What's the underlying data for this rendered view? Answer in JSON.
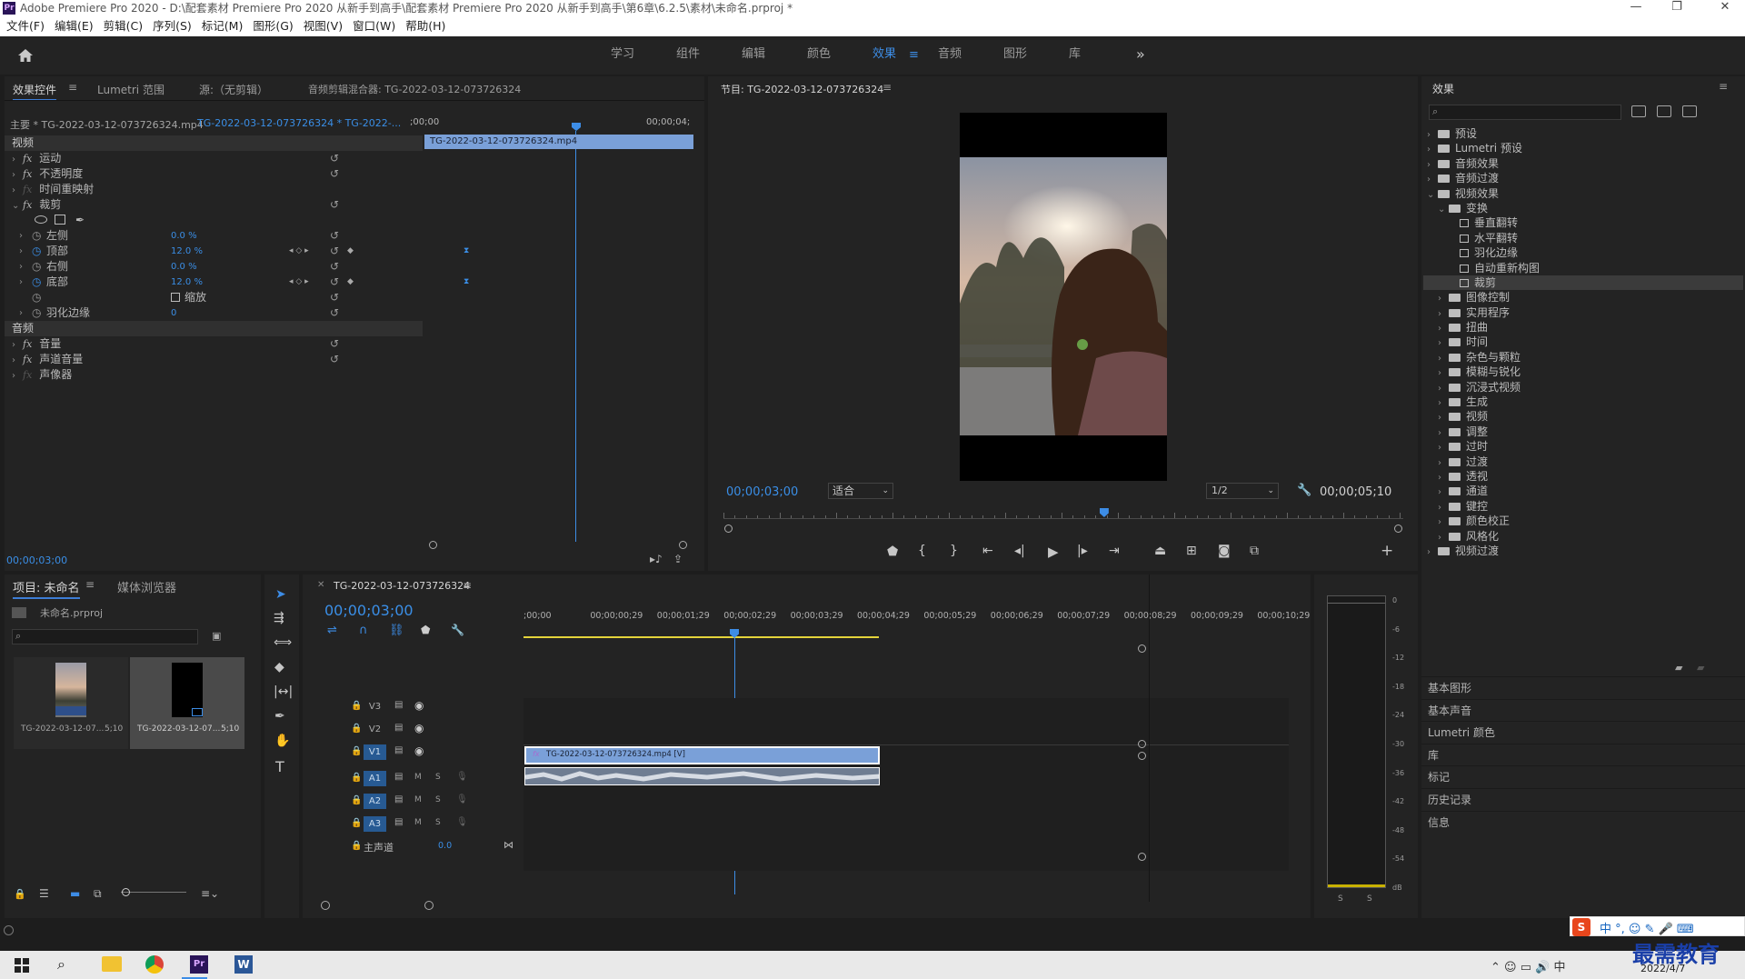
{
  "window": {
    "title": "Adobe Premiere Pro 2020 - D:\\配套素材 Premiere Pro 2020 从新手到高手\\配套素材 Premiere Pro 2020 从新手到高手\\第6章\\6.2.5\\素材\\未命名.prproj *",
    "logo": "Pr",
    "minimize": "—",
    "restore": "❐",
    "close": "✕"
  },
  "menu": [
    "文件(F)",
    "编辑(E)",
    "剪辑(C)",
    "序列(S)",
    "标记(M)",
    "图形(G)",
    "视图(V)",
    "窗口(W)",
    "帮助(H)"
  ],
  "workspaces": {
    "tabs": [
      "学习",
      "组件",
      "编辑",
      "颜色",
      "效果",
      "音频",
      "图形",
      "库"
    ],
    "active": "效果",
    "more": "»"
  },
  "effect_controls": {
    "tabs": [
      "效果控件",
      "Lumetri 范围",
      "源:（无剪辑）",
      "音频剪辑混合器: TG-2022-03-12-073726324"
    ],
    "master": "主要 * TG-2022-03-12-073726324.mp4",
    "sequence_clip": "TG-2022-03-12-073726324 * TG-2022-...",
    "ruler_start": ";00;00",
    "ruler_end": "00;00;04;",
    "clip_bar": "TG-2022-03-12-073726324.mp4",
    "video_section": "视频",
    "audio_section": "音频",
    "video_effects": [
      {
        "name": "运动",
        "fx": true
      },
      {
        "name": "不透明度",
        "fx": true
      },
      {
        "name": "时间重映射",
        "fx": false
      },
      {
        "name": "裁剪",
        "fx": true
      }
    ],
    "crop_params": [
      {
        "name": "左侧",
        "value": "0.0 %",
        "animated": false
      },
      {
        "name": "顶部",
        "value": "12.0 %",
        "animated": true
      },
      {
        "name": "右侧",
        "value": "0.0 %",
        "animated": false
      },
      {
        "name": "底部",
        "value": "12.0 %",
        "animated": true
      },
      {
        "name": "",
        "value": "",
        "checkbox": "缩放"
      },
      {
        "name": "羽化边缘",
        "value": "0",
        "animated": false
      }
    ],
    "audio_effects": [
      {
        "name": "音量",
        "fx": true
      },
      {
        "name": "声道音量",
        "fx": true
      },
      {
        "name": "声像器",
        "fx": false
      }
    ],
    "timecode": "00;00;03;00"
  },
  "program": {
    "title": "节目: TG-2022-03-12-073726324",
    "timecode": "00;00;03;00",
    "fit": "适合",
    "resolution": "1/2",
    "duration": "00;00;05;10",
    "playhead_fraction": 0.56
  },
  "effects_panel": {
    "title": "效果",
    "tree": [
      {
        "label": "预设",
        "level": 0,
        "type": "folder",
        "open": false
      },
      {
        "label": "Lumetri 预设",
        "level": 0,
        "type": "folder",
        "open": false
      },
      {
        "label": "音频效果",
        "level": 0,
        "type": "folder",
        "open": false
      },
      {
        "label": "音频过渡",
        "level": 0,
        "type": "folder",
        "open": false
      },
      {
        "label": "视频效果",
        "level": 0,
        "type": "folder",
        "open": true
      },
      {
        "label": "变换",
        "level": 1,
        "type": "folder",
        "open": true
      },
      {
        "label": "垂直翻转",
        "level": 2,
        "type": "effect"
      },
      {
        "label": "水平翻转",
        "level": 2,
        "type": "effect"
      },
      {
        "label": "羽化边缘",
        "level": 2,
        "type": "effect"
      },
      {
        "label": "自动重新构图",
        "level": 2,
        "type": "effect"
      },
      {
        "label": "裁剪",
        "level": 2,
        "type": "effect",
        "selected": true
      },
      {
        "label": "图像控制",
        "level": 1,
        "type": "folder",
        "open": false
      },
      {
        "label": "实用程序",
        "level": 1,
        "type": "folder",
        "open": false
      },
      {
        "label": "扭曲",
        "level": 1,
        "type": "folder",
        "open": false
      },
      {
        "label": "时间",
        "level": 1,
        "type": "folder",
        "open": false
      },
      {
        "label": "杂色与颗粒",
        "level": 1,
        "type": "folder",
        "open": false
      },
      {
        "label": "模糊与锐化",
        "level": 1,
        "type": "folder",
        "open": false
      },
      {
        "label": "沉浸式视频",
        "level": 1,
        "type": "folder",
        "open": false
      },
      {
        "label": "生成",
        "level": 1,
        "type": "folder",
        "open": false
      },
      {
        "label": "视频",
        "level": 1,
        "type": "folder",
        "open": false
      },
      {
        "label": "调整",
        "level": 1,
        "type": "folder",
        "open": false
      },
      {
        "label": "过时",
        "level": 1,
        "type": "folder",
        "open": false
      },
      {
        "label": "过渡",
        "level": 1,
        "type": "folder",
        "open": false
      },
      {
        "label": "透视",
        "level": 1,
        "type": "folder",
        "open": false
      },
      {
        "label": "通道",
        "level": 1,
        "type": "folder",
        "open": false
      },
      {
        "label": "键控",
        "level": 1,
        "type": "folder",
        "open": false
      },
      {
        "label": "颜色校正",
        "level": 1,
        "type": "folder",
        "open": false
      },
      {
        "label": "风格化",
        "level": 1,
        "type": "folder",
        "open": false
      },
      {
        "label": "视频过渡",
        "level": 0,
        "type": "folder",
        "open": false
      }
    ],
    "sections": [
      "基本图形",
      "基本声音",
      "Lumetri 颜色",
      "库",
      "标记",
      "历史记录",
      "信息"
    ]
  },
  "project": {
    "tabs": [
      "项目: 未命名",
      "媒体浏览器"
    ],
    "file": "未命名.prproj",
    "items": [
      {
        "name": "TG-2022-03-12-07...",
        "duration": "5;10"
      },
      {
        "name": "TG-2022-03-12-07...",
        "duration": "5;10"
      }
    ]
  },
  "timeline": {
    "title": "TG-2022-03-12-073726324",
    "timecode": "00;00;03;00",
    "ruler": [
      ";00;00",
      "00;00;00;29",
      "00;00;01;29",
      "00;00;02;29",
      "00;00;03;29",
      "00;00;04;29",
      "00;00;05;29",
      "00;00;06;29",
      "00;00;07;29",
      "00;00;08;29",
      "00;00;09;29",
      "00;00;10;29"
    ],
    "video_tracks": [
      "V3",
      "V2",
      "V1"
    ],
    "audio_tracks": [
      "A1",
      "A2",
      "A3"
    ],
    "master": "主声道",
    "master_value": "0.0",
    "video_clip": "TG-2022-03-12-073726324.mp4 [V]",
    "mute": "M",
    "solo": "S"
  },
  "meter": {
    "labels": [
      "0",
      "-6",
      "-12",
      "-18",
      "-24",
      "-30",
      "-36",
      "-42",
      "-48",
      "-54",
      "dB"
    ],
    "solo": [
      "S",
      "S"
    ]
  },
  "ime": {
    "text": "中 °, ☺ ✎ 🎤 ⌨"
  },
  "taskbar": {
    "date": "2022/4/7",
    "watermark": "最需教育"
  },
  "colors": {
    "accent": "#3d8de6",
    "clip_video": "#7aa0d8",
    "panel": "#232323",
    "bg": "#1d1d1d"
  }
}
